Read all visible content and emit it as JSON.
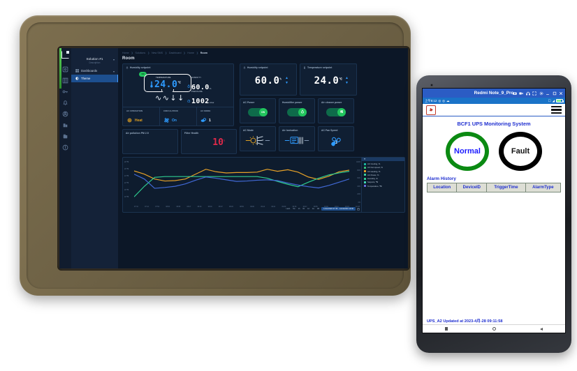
{
  "tablet": {
    "rail_icons": [
      "app-logo",
      "dashboard-icon",
      "grid-icon",
      "key-icon",
      "alarm-bell-icon",
      "user-icon",
      "building-icon",
      "archive-icon",
      "info-icon"
    ],
    "sidebar": {
      "solution_title": "Solution #1",
      "solution_sub": "Description",
      "items": [
        {
          "label": "Dashboards",
          "icon": "grid-icon",
          "active": false
        },
        {
          "label": "Theme",
          "icon": "contrast-icon",
          "active": true
        }
      ]
    },
    "breadcrumb": [
      "Home",
      "Solutions",
      "New SMS",
      "Dashboard",
      "Home",
      "Room"
    ],
    "page_title": "Room",
    "room_card": {
      "label": "Humidity setpoint",
      "temp_caption": "TEMPERATURE",
      "temp_value": "24.0",
      "temp_unit": "℃",
      "power_badge": "ON",
      "humidity": {
        "label": "HUMIDITY",
        "value": "60.0",
        "unit": "%"
      },
      "pressure": {
        "label": "PRESSURE",
        "value": "1002",
        "unit": "mbar"
      },
      "sub": [
        {
          "label": "AC OPERATION",
          "value": "Heat",
          "color": "#e0a021",
          "icon": "flame-coil-icon"
        },
        {
          "label": "CIRCULATION",
          "value": "On",
          "color": "#2e9bff",
          "icon": "fan-icon"
        },
        {
          "label": "AC MODE",
          "value": "1",
          "color": "#ffffff",
          "icon": "mode-icon"
        }
      ]
    },
    "setpoints": [
      {
        "label": "Humidity setpoint",
        "icon": "droplet-icon",
        "value": "60.0",
        "unit": "%"
      },
      {
        "label": "Temperature setpoint",
        "icon": "thermometer-icon",
        "value": "24.0",
        "unit": "℃"
      }
    ],
    "toggles": [
      {
        "label": "AC Power",
        "state": "ON",
        "knob_icon": "text-on"
      },
      {
        "label": "Humidifier power",
        "state": "ON",
        "knob_icon": "droplet-icon"
      },
      {
        "label": "Air cleaner power",
        "state": "ON",
        "knob_icon": "sliders-icon"
      }
    ],
    "modes": [
      {
        "label": "AC Mode",
        "icon": "heat-mode-icon"
      },
      {
        "label": "Air Ionisation",
        "icon": "ionisation-icon"
      },
      {
        "label": "AC Fan Speed",
        "icon": "fan-speed-icon",
        "value": "1"
      }
    ],
    "pm_card": {
      "label": "Air pollution PM 2.5"
    },
    "filter_card": {
      "label": "Filter Health",
      "value": "10",
      "unit": "%"
    },
    "chart": {
      "y_ticks_left": [
        "28 ℃",
        "26 ℃",
        "24 ℃",
        "22 ℃",
        "20 ℃",
        "18 ℃"
      ],
      "y_ticks_right": [
        "100%",
        "80%",
        "60%",
        "40%",
        "20%",
        "0%"
      ],
      "x_ticks": [
        "07:34",
        "07:44",
        "07:52",
        "08:00",
        "08:08",
        "08:17",
        "08:23",
        "08:30",
        "08:37",
        "08:45",
        "08:50",
        "09:00",
        "09:14",
        "09:21",
        "09:30",
        "09:36",
        "09:47",
        "09:55",
        "10:02",
        "10:11",
        "10:19",
        "10:28"
      ],
      "legend": [
        {
          "name": "AC Cooling, %",
          "color": "#18b8a0"
        },
        {
          "name": "AC Fan speed, %",
          "color": "#36c17a"
        },
        {
          "name": "AC Heating, %",
          "color": "#e6a128"
        },
        {
          "name": "AC Power, %",
          "color": "#3ad29f"
        },
        {
          "name": "Humidity, %",
          "color": "#2ecc8f"
        },
        {
          "name": "Setpoint, ℃",
          "color": "#3fd6b5"
        },
        {
          "name": "Temperature, ℃",
          "color": "#6b6bdd"
        }
      ],
      "ranges": [
        "Last1",
        "5m",
        "1h",
        "6h",
        "1d",
        "1w",
        "1M"
      ],
      "range_selected": "14/12/2023 07:30 - 14/12/2023 10:30",
      "calendar_icon": "calendar-icon"
    },
    "chart_data": {
      "type": "line",
      "title": "",
      "xlabel": "",
      "ylabel": "",
      "grid": false,
      "legend_position": "right",
      "ylim": [
        18,
        28
      ],
      "x": [
        "07:34",
        "07:44",
        "07:52",
        "08:00",
        "08:08",
        "08:17",
        "08:23",
        "08:30",
        "08:37",
        "08:45",
        "08:50",
        "09:00",
        "09:14",
        "09:21",
        "09:30",
        "09:36",
        "09:47",
        "09:55",
        "10:02",
        "10:11",
        "10:19",
        "10:28"
      ],
      "series": [
        {
          "name": "AC Heating, %",
          "color": "#e6a128",
          "values": [
            25.4,
            24.6,
            23.4,
            22.9,
            23.0,
            23.4,
            24.6,
            25.8,
            25.2,
            24.9,
            25.0,
            25.0,
            25.1,
            25.8,
            25.3,
            25.7,
            25.1,
            23.9,
            23.3,
            24.1,
            25.2,
            25.6
          ]
        },
        {
          "name": "AC Fan speed, %",
          "color": "#2ecc8f",
          "values": [
            19.0,
            21.6,
            23.8,
            24.0,
            24.0,
            24.0,
            24.0,
            24.0,
            24.0,
            24.0,
            24.0,
            24.0,
            24.0,
            23.6,
            22.8,
            22.1,
            21.5,
            22.6,
            23.6,
            24.4,
            24.9,
            25.3
          ]
        },
        {
          "name": "Temperature, ℃",
          "color": "#4169d6",
          "values": [
            24.6,
            23.4,
            21.1,
            21.3,
            21.6,
            22.2,
            23.1,
            23.9,
            23.6,
            23.2,
            22.8,
            22.9,
            23.1,
            23.2,
            23.0,
            22.4,
            21.9,
            21.5,
            21.2,
            21.8,
            22.6,
            23.4
          ]
        }
      ]
    }
  },
  "phone": {
    "window_title": "Redmi Note_9_Pro",
    "window_controls": [
      "camera-icon",
      "video-icon",
      "headphone-icon",
      "fullscreen-icon",
      "gear-icon",
      "minimize-icon",
      "maximize-icon",
      "close-icon"
    ],
    "status_bar": {
      "time": "上午8:12",
      "left_icons": [
        "circle-icon",
        "circle-icon",
        "cloud-icon"
      ],
      "right_icons": [
        "cast-icon",
        "wifi-icon",
        "battery-icon"
      ]
    },
    "app_bar": {
      "logo_icon": "app-brand-icon",
      "menu_icon": "hamburger-icon"
    },
    "app_title": "BCF1 UPS Monitoring System",
    "status_circles": [
      {
        "label": "Normal",
        "ring_color": "#0b8a12",
        "text_color": "#1a1aff"
      },
      {
        "label": "Fault",
        "ring_color": "#000000",
        "text_color": "#111111"
      }
    ],
    "alarm_history_title": "Alarm History",
    "alarm_table": {
      "columns": [
        "Location",
        "DeviceID",
        "TriggerTime",
        "AlarmType"
      ],
      "rows": []
    },
    "footer_status": "UPS_A2 Updated at 2023-4月-28 09:11:58",
    "nav_buttons": [
      "recents-square-icon",
      "home-circle-icon",
      "back-triangle-icon"
    ]
  }
}
